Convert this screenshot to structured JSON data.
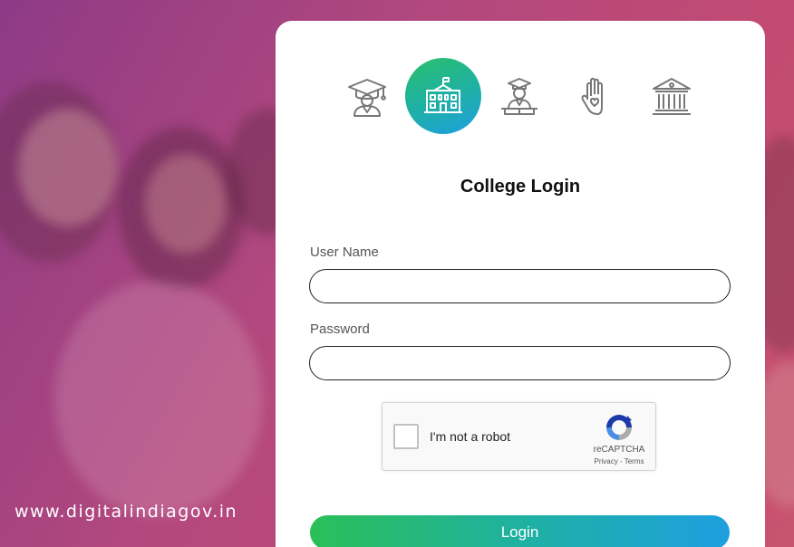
{
  "watermark": "www.digitalindiagov.in",
  "roles": [
    {
      "name": "student",
      "icon": "graduate-icon",
      "active": false
    },
    {
      "name": "college",
      "icon": "college-building-icon",
      "active": true
    },
    {
      "name": "teacher",
      "icon": "teacher-icon",
      "active": false
    },
    {
      "name": "volunteer",
      "icon": "hand-heart-icon",
      "active": false
    },
    {
      "name": "institution",
      "icon": "bank-building-icon",
      "active": false
    }
  ],
  "form": {
    "title": "College Login",
    "username_label": "User Name",
    "username_value": "",
    "password_label": "Password",
    "password_value": "",
    "submit_label": "Login"
  },
  "captcha": {
    "label": "I'm not a robot",
    "brand": "reCAPTCHA",
    "links": "Privacy - Terms"
  },
  "colors": {
    "accent_green": "#2bbf58",
    "accent_blue": "#1e9fe0",
    "icon_gray": "#777777"
  }
}
